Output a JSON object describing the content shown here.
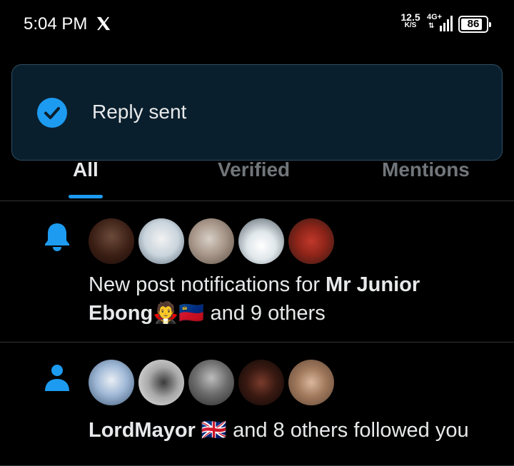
{
  "status_bar": {
    "time": "5:04 PM",
    "speed_value": "12.5",
    "speed_unit": "K/S",
    "network": "4G+",
    "battery": "86",
    "battery_level": 0.86,
    "app_icon": "x-logo-icon"
  },
  "toast": {
    "icon": "check-circle-icon",
    "message": "Reply sent",
    "accent": "#1d9bf0"
  },
  "tabs": [
    {
      "label": "All",
      "active": true
    },
    {
      "label": "Verified",
      "active": false
    },
    {
      "label": "Mentions",
      "active": false
    }
  ],
  "notifications": [
    {
      "icon": "bell-icon",
      "avatars": [
        "avatar",
        "avatar",
        "avatar",
        "avatar",
        "avatar"
      ],
      "line1_prefix": "New post notifications for ",
      "line1_name": "Mr Junior",
      "line2_name": "Ebong",
      "line2_emoji": "🧛🇱🇮",
      "line2_suffix": " and 9 others"
    },
    {
      "icon": "person-icon",
      "avatars": [
        "avatar",
        "avatar",
        "avatar",
        "avatar",
        "avatar"
      ],
      "name": "LordMayor",
      "emoji": "🇬🇧",
      "suffix": " and 8 others followed you"
    }
  ],
  "colors": {
    "background": "#000000",
    "accent": "#1d9bf0",
    "muted": "#71767b",
    "divider": "#2f3336"
  }
}
